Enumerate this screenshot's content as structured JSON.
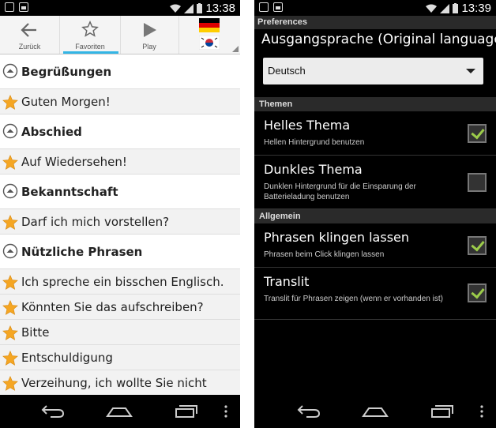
{
  "left_screen": {
    "status": {
      "time": "13:38"
    },
    "actionbar": {
      "back_label": "Zurück",
      "favorites_label": "Favoriten",
      "play_label": "Play"
    },
    "list": {
      "items": [
        {
          "kind": "header",
          "text": "Begrüßungen"
        },
        {
          "kind": "phrase",
          "text": "Guten Morgen!"
        },
        {
          "kind": "header",
          "text": "Abschied"
        },
        {
          "kind": "phrase",
          "text": "Auf Wiedersehen!"
        },
        {
          "kind": "header",
          "text": "Bekanntschaft"
        },
        {
          "kind": "phrase",
          "text": "Darf ich mich vorstellen?"
        },
        {
          "kind": "header",
          "text": "Nützliche Phrasen"
        },
        {
          "kind": "phrase",
          "text": "Ich spreche ein bisschen Englisch."
        },
        {
          "kind": "phrase",
          "text": "Könnten Sie das aufschreiben?"
        },
        {
          "kind": "phrase",
          "text": "Bitte"
        },
        {
          "kind": "phrase",
          "text": "Entschuldigung"
        },
        {
          "kind": "phrase",
          "text": "Verzeihung, ich wollte Sie nicht"
        }
      ]
    }
  },
  "right_screen": {
    "status": {
      "time": "13:39"
    },
    "title": "Preferences",
    "language": {
      "label": "Ausgangsprache (Original language)",
      "value": "Deutsch"
    },
    "sections": {
      "themes": "Themen",
      "general": "Allgemein"
    },
    "prefs": {
      "light": {
        "title": "Helles Thema",
        "summary": "Hellen Hintergrund benutzen",
        "checked": true
      },
      "dark": {
        "title": "Dunkles Thema",
        "summary": "Dunklen Hintergrund für die Einsparung der Batterieladung benutzen",
        "checked": false
      },
      "sound": {
        "title": "Phrasen klingen lassen",
        "summary": "Phrasen beim Click klingen lassen",
        "checked": true
      },
      "translit": {
        "title": "Translit",
        "summary": "Translit für Phrasen zeigen (wenn er vorhanden ist)",
        "checked": true
      }
    }
  },
  "colors": {
    "accent": "#33b5e5",
    "star": "#f5a623",
    "check": "#9ccc4a"
  }
}
